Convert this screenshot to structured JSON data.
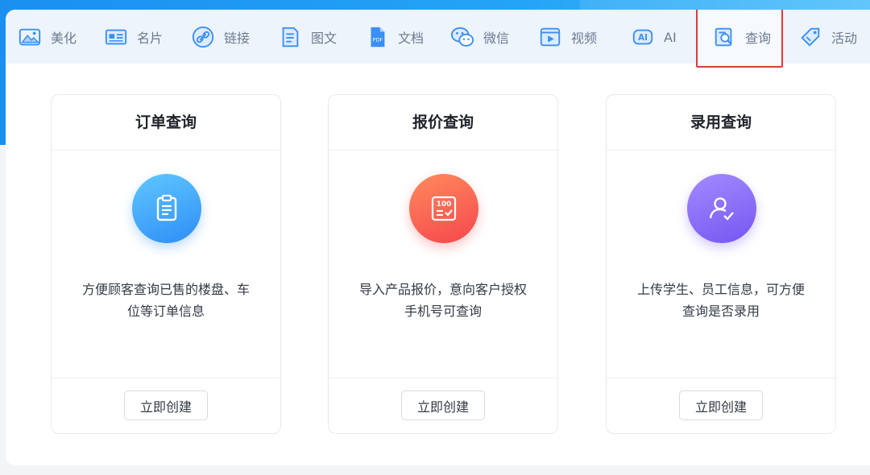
{
  "tabs": [
    {
      "label": "美化",
      "icon": "image-icon"
    },
    {
      "label": "名片",
      "icon": "id-card-icon"
    },
    {
      "label": "链接",
      "icon": "link-icon"
    },
    {
      "label": "图文",
      "icon": "document-text-icon"
    },
    {
      "label": "文档",
      "icon": "pdf-file-icon"
    },
    {
      "label": "微信",
      "icon": "wechat-icon"
    },
    {
      "label": "视频",
      "icon": "video-icon"
    },
    {
      "label": "AI",
      "icon": "ai-icon"
    },
    {
      "label": "查询",
      "icon": "search-document-icon",
      "active": true
    },
    {
      "label": "活动",
      "icon": "activity-tag-icon"
    }
  ],
  "colors": {
    "accent_blue": "#2f8df6",
    "active_outline": "#e53935",
    "tab_text": "#6b7a90"
  },
  "cards": [
    {
      "title": "订单查询",
      "icon": "clipboard-icon",
      "desc_line1": "方便顾客查询已售的楼盘、车",
      "desc_line2": "位等订单信息",
      "button": "立即创建"
    },
    {
      "title": "报价查询",
      "icon": "score-100-icon",
      "desc_line1": "导入产品报价，意向客户授权",
      "desc_line2": "手机号可查询",
      "button": "立即创建"
    },
    {
      "title": "录用查询",
      "icon": "user-check-icon",
      "desc_line1": "上传学生、员工信息，可方便",
      "desc_line2": "查询是否录用",
      "button": "立即创建"
    }
  ]
}
